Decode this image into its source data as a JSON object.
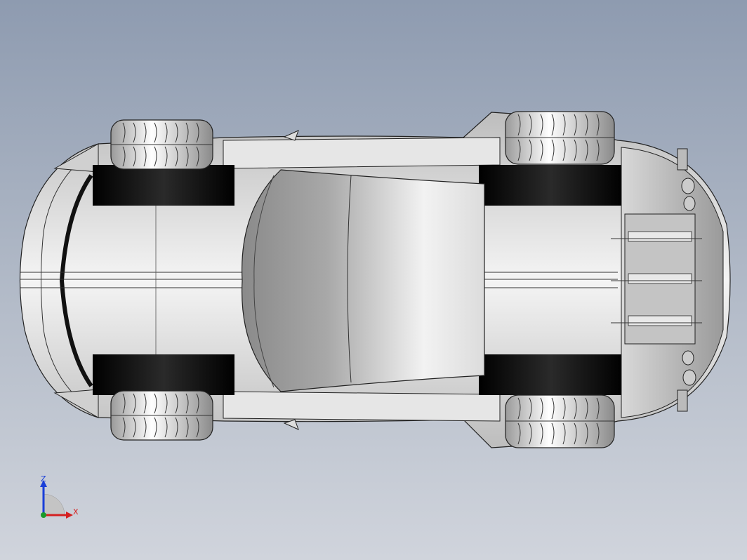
{
  "app": {
    "window": "cad-3d-viewport",
    "view": "top"
  },
  "model": {
    "name": "race-car",
    "parts": [
      "body",
      "cockpit",
      "front-wheel-left",
      "front-wheel-right",
      "rear-wheel-left",
      "rear-wheel-right",
      "rear-wing",
      "rear-diffuser"
    ]
  },
  "triad": {
    "z_label": "Z",
    "x_label": "X",
    "z_color": "#1a3fd8",
    "x_color": "#d42020",
    "origin_color": "#1a9a2a"
  },
  "colors": {
    "background_top": "#8e9bb0",
    "background_bottom": "#d0d4dc",
    "body": "#e2e2e2",
    "tire": "#f0f0f0",
    "shadow": "#111111"
  }
}
